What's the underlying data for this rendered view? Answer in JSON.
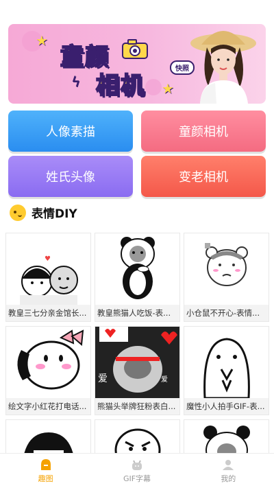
{
  "banner": {
    "title_line1": "童颜",
    "title_line2": "相机",
    "badge": "快照"
  },
  "buttons": [
    {
      "label": "人像素描",
      "color": "#2a8df0"
    },
    {
      "label": "童颜相机",
      "color": "#f46b81"
    },
    {
      "label": "姓氏头像",
      "color": "#8a6cf1"
    },
    {
      "label": "变老相机",
      "color": "#f4584a"
    }
  ],
  "section": {
    "title": "表情DIY",
    "icon": "smiley-face-icon"
  },
  "cards": [
    {
      "caption": "教皇三七分亲金馆长...",
      "icon": "two-faces-sticker"
    },
    {
      "caption": "教皇熊猫人吃饭-表...",
      "icon": "panda-eating-sticker"
    },
    {
      "caption": "小仓鼠不开心-表情...",
      "icon": "hamster-sticker"
    },
    {
      "caption": "绘文字小红花打电话...",
      "icon": "phone-bow-sticker"
    },
    {
      "caption": "熊猫头举牌狂粉表白...",
      "icon": "panda-hearts-sticker"
    },
    {
      "caption": "魔性小人拍手GIF-表...",
      "icon": "clapping-man-sticker"
    },
    {
      "caption": "",
      "icon": "hair-girl-sticker"
    },
    {
      "caption": "",
      "icon": "angry-face-sticker"
    },
    {
      "caption": "",
      "icon": "panda-head-sticker"
    }
  ],
  "nav": {
    "tabs": [
      {
        "label": "趣图",
        "active": true,
        "icon": "fun-icon"
      },
      {
        "label": "GIF字幕",
        "active": false,
        "icon": "gif-icon"
      },
      {
        "label": "我的",
        "active": false,
        "icon": "profile-icon"
      }
    ],
    "active_color": "#f5a200"
  }
}
